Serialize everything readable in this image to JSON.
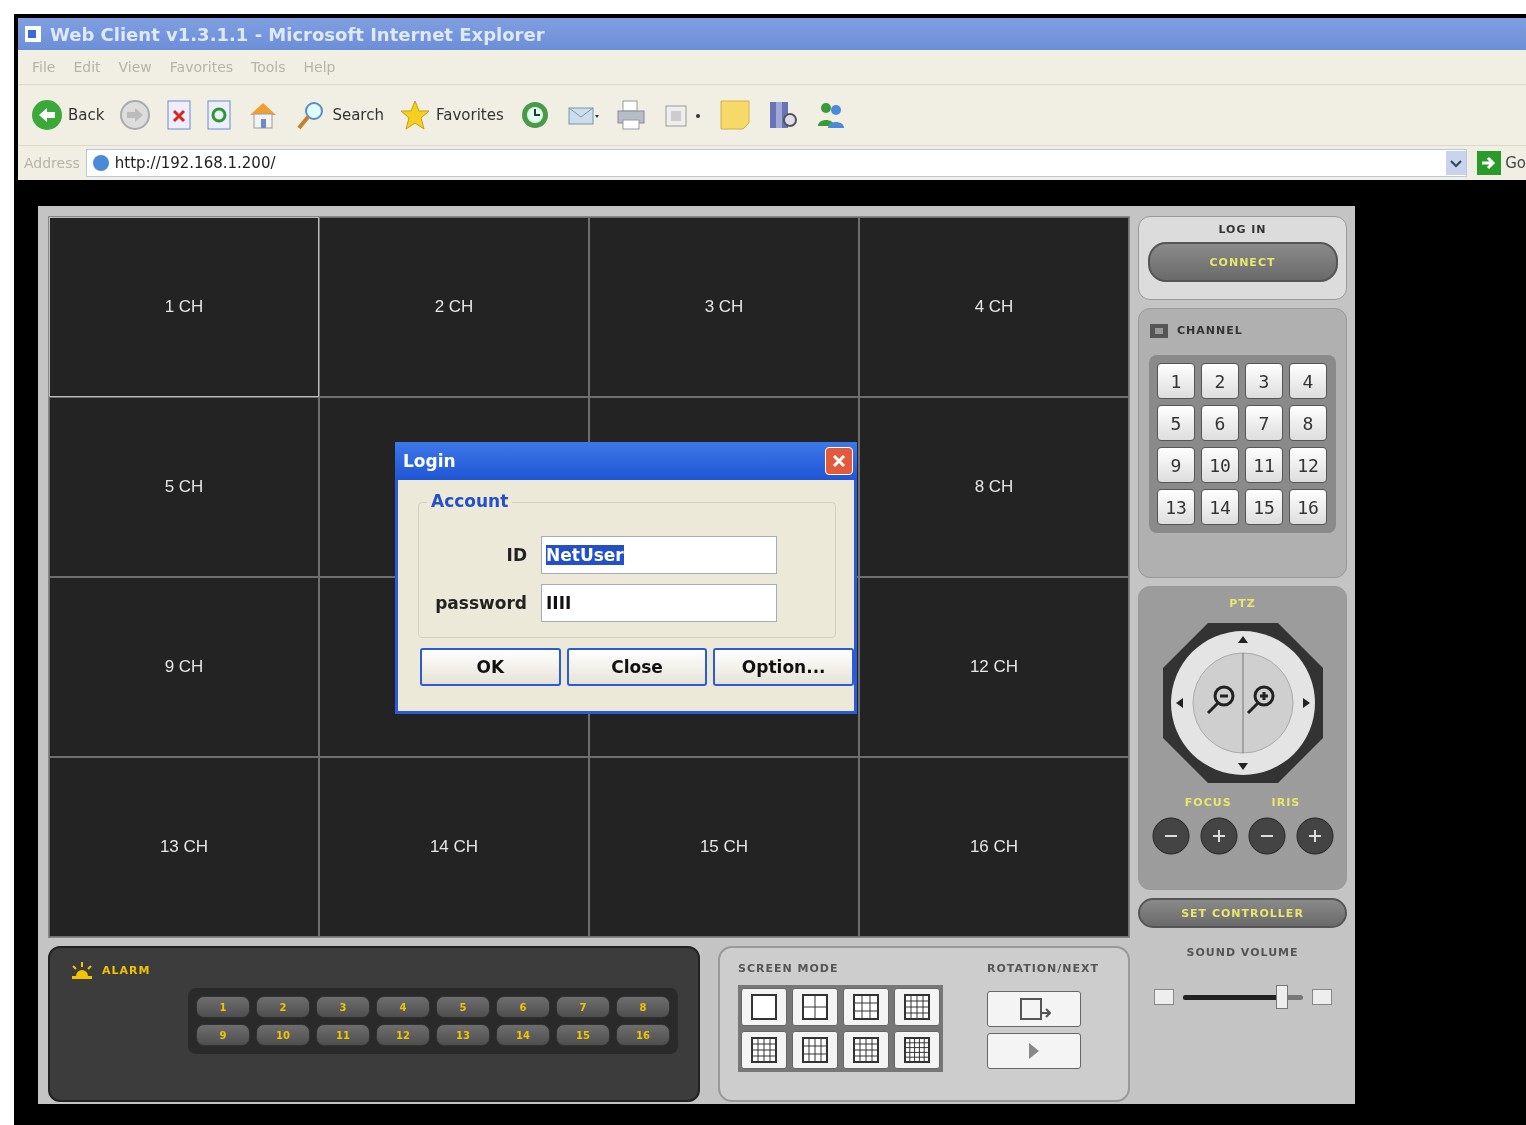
{
  "browser": {
    "title": "Web Client v1.3.1.1 - Microsoft Internet Explorer",
    "menu": [
      "File",
      "Edit",
      "View",
      "Favorites",
      "Tools",
      "Help"
    ],
    "toolbar": [
      {
        "kind": "back",
        "label": "Back"
      },
      {
        "kind": "forward"
      },
      {
        "kind": "stop"
      },
      {
        "kind": "refresh"
      },
      {
        "kind": "home"
      },
      {
        "kind": "search",
        "label": "Search"
      },
      {
        "kind": "favorites",
        "label": "Favorites"
      },
      {
        "kind": "history"
      },
      {
        "kind": "mail"
      },
      {
        "kind": "print"
      },
      {
        "kind": "edit"
      },
      {
        "kind": "note"
      },
      {
        "kind": "research"
      },
      {
        "kind": "messenger"
      }
    ],
    "address": {
      "label": "Address",
      "url": "http://192.168.1.200/",
      "go": "Go"
    }
  },
  "channels": [
    {
      "label": "1 CH",
      "selected": true
    },
    {
      "label": "2 CH",
      "selected": false
    },
    {
      "label": "3 CH",
      "selected": false
    },
    {
      "label": "4 CH",
      "selected": false
    },
    {
      "label": "5 CH",
      "selected": false
    },
    {
      "selected": false
    },
    {
      "selected": false
    },
    {
      "label": "8 CH",
      "selected": false
    },
    {
      "label": "9 CH",
      "selected": false
    },
    {
      "selected": false
    },
    {
      "selected": false
    },
    {
      "label": "12 CH",
      "selected": false
    },
    {
      "label": "13 CH",
      "selected": false
    },
    {
      "label": "14 CH",
      "selected": false
    },
    {
      "label": "15 CH",
      "selected": false
    },
    {
      "label": "16 CH",
      "selected": false
    }
  ],
  "login_dialog": {
    "title": "Login",
    "group": "Account",
    "id_label": "ID",
    "id_value": "NetUser",
    "id_highlighted": true,
    "password_label": "password",
    "password_value": "IIII",
    "buttons": [
      "OK",
      "Close",
      "Option..."
    ]
  },
  "login_panel": {
    "title": "LOG IN",
    "button": "CONNECT"
  },
  "channel_panel": {
    "title": "CHANNEL",
    "buttons": [
      "1",
      "2",
      "3",
      "4",
      "5",
      "6",
      "7",
      "8",
      "9",
      "10",
      "11",
      "12",
      "13",
      "14",
      "15",
      "16"
    ]
  },
  "ptz_panel": {
    "title": "PTZ",
    "focus": "FOCUS",
    "iris": "IRIS",
    "button": "SET CONTROLLER"
  },
  "alarm_panel": {
    "title": "ALARM",
    "buttons": [
      "1",
      "2",
      "3",
      "4",
      "5",
      "6",
      "7",
      "8",
      "9",
      "10",
      "11",
      "12",
      "13",
      "14",
      "15",
      "16"
    ]
  },
  "screen_mode": {
    "title": "SCREEN MODE",
    "rotation_title": "ROTATION/NEXT"
  },
  "sound": {
    "title": "SOUND VOLUME",
    "level": 0.85
  }
}
